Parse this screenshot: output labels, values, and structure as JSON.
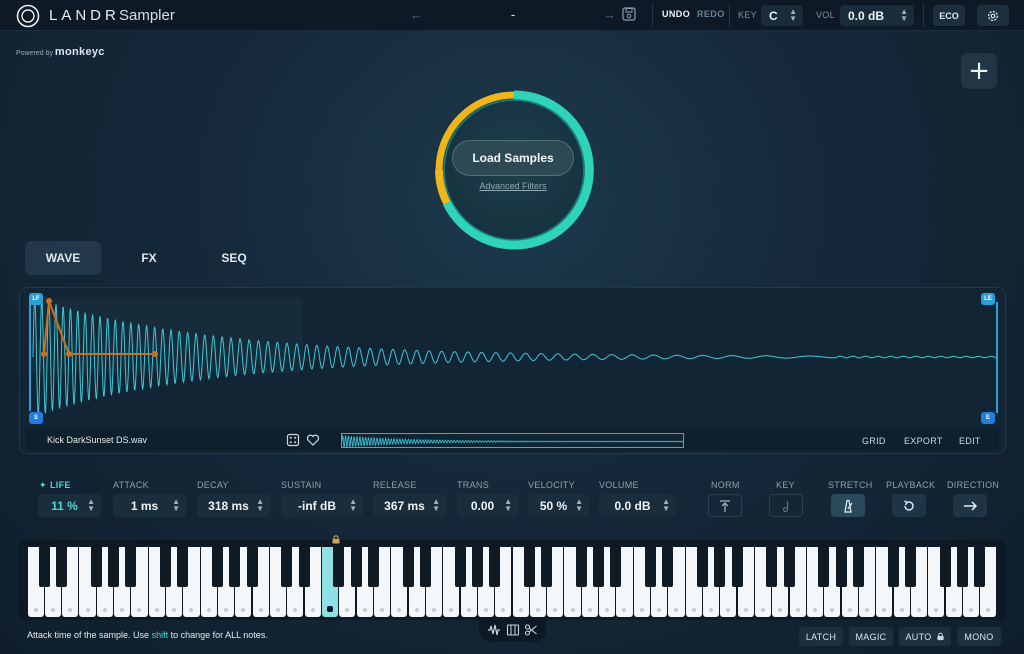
{
  "topbar": {
    "brand": "LANDR",
    "product": "Sampler",
    "preset_name": "-",
    "undo_label": "UNDO",
    "redo_label": "REDO",
    "key_label": "KEY",
    "key_value": "C",
    "vol_label": "VOL",
    "vol_value": "0.0 dB",
    "eco_label": "ECO"
  },
  "powered": {
    "prefix": "Powered by",
    "name": "monkeyc"
  },
  "loader": {
    "button": "Load Samples",
    "filters_link": "Advanced Filters"
  },
  "tabs": [
    {
      "label": "WAVE",
      "active": true
    },
    {
      "label": "FX",
      "active": false
    },
    {
      "label": "SEQ",
      "active": false
    }
  ],
  "waveform": {
    "markers": {
      "loop_start": "LF",
      "loop_end": "LE",
      "start": "S",
      "end": "E"
    },
    "sample_name": "Kick DarkSunset DS.wav",
    "buttons": {
      "grid": "GRID",
      "export": "EXPORT",
      "edit": "EDIT"
    },
    "wave_color": "#3ec7d8",
    "envelope_color": "#c8711f"
  },
  "params": [
    {
      "label": "LIFE",
      "value": "11 %",
      "highlight": true
    },
    {
      "label": "ATTACK",
      "value": "1 ms"
    },
    {
      "label": "DECAY",
      "value": "318 ms"
    },
    {
      "label": "SUSTAIN",
      "value": "-inf dB"
    },
    {
      "label": "RELEASE",
      "value": "367 ms"
    },
    {
      "label": "TRANS",
      "value": "0.00"
    },
    {
      "label": "VELOCITY",
      "value": "50 %"
    },
    {
      "label": "VOLUME",
      "value": "0.0 dB"
    }
  ],
  "toggles": [
    {
      "label": "NORM",
      "icon": "normalize-icon"
    },
    {
      "label": "KEY",
      "icon": "key-note-icon"
    },
    {
      "label": "STRETCH",
      "icon": "metronome-icon"
    },
    {
      "label": "PLAYBACK",
      "icon": "loop-icon"
    },
    {
      "label": "DIRECTION",
      "icon": "arrow-right-icon"
    }
  ],
  "status": {
    "before": "Attack time of the sample. Use ",
    "highlight": "shift",
    "after": " to change for ALL notes."
  },
  "bottom_buttons": {
    "latch": "LATCH",
    "magic": "MAGIC",
    "auto": "AUTO",
    "mono": "MONO"
  },
  "colors": {
    "accent": "#4cd7d2",
    "ring_teal": "#2fd3b8",
    "ring_yellow": "#f1b51c",
    "marker_blue": "#1e7fe0"
  }
}
